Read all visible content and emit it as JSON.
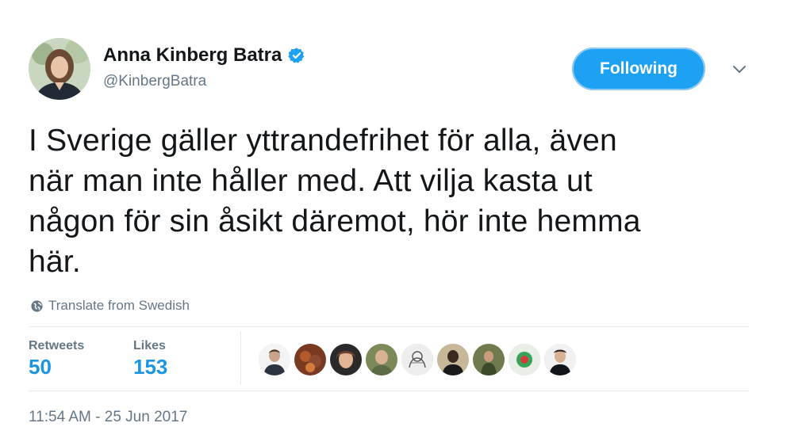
{
  "author": {
    "name": "Anna Kinberg Batra",
    "handle": "@KinbergBatra",
    "verified_icon": "verified-badge-icon"
  },
  "actions": {
    "follow_label": "Following",
    "more_icon": "chevron-down-icon"
  },
  "tweet": {
    "text": "I Sverige gäller yttrandefrihet för alla, även\nnär man inte håller med. Att vilja kasta ut\nnågon för sin åsikt däremot, hör inte hemma\nhär.",
    "translate_label": "Translate from Swedish",
    "translate_icon": "globe-icon",
    "timestamp": "11:54 AM - 25 Jun 2017"
  },
  "stats": {
    "retweets_label": "Retweets",
    "retweets_value": "50",
    "likes_label": "Likes",
    "likes_value": "153"
  },
  "colors": {
    "accent": "#1da1f2",
    "stat_value": "#1b95e0",
    "muted": "#657786",
    "text": "#14171a"
  }
}
